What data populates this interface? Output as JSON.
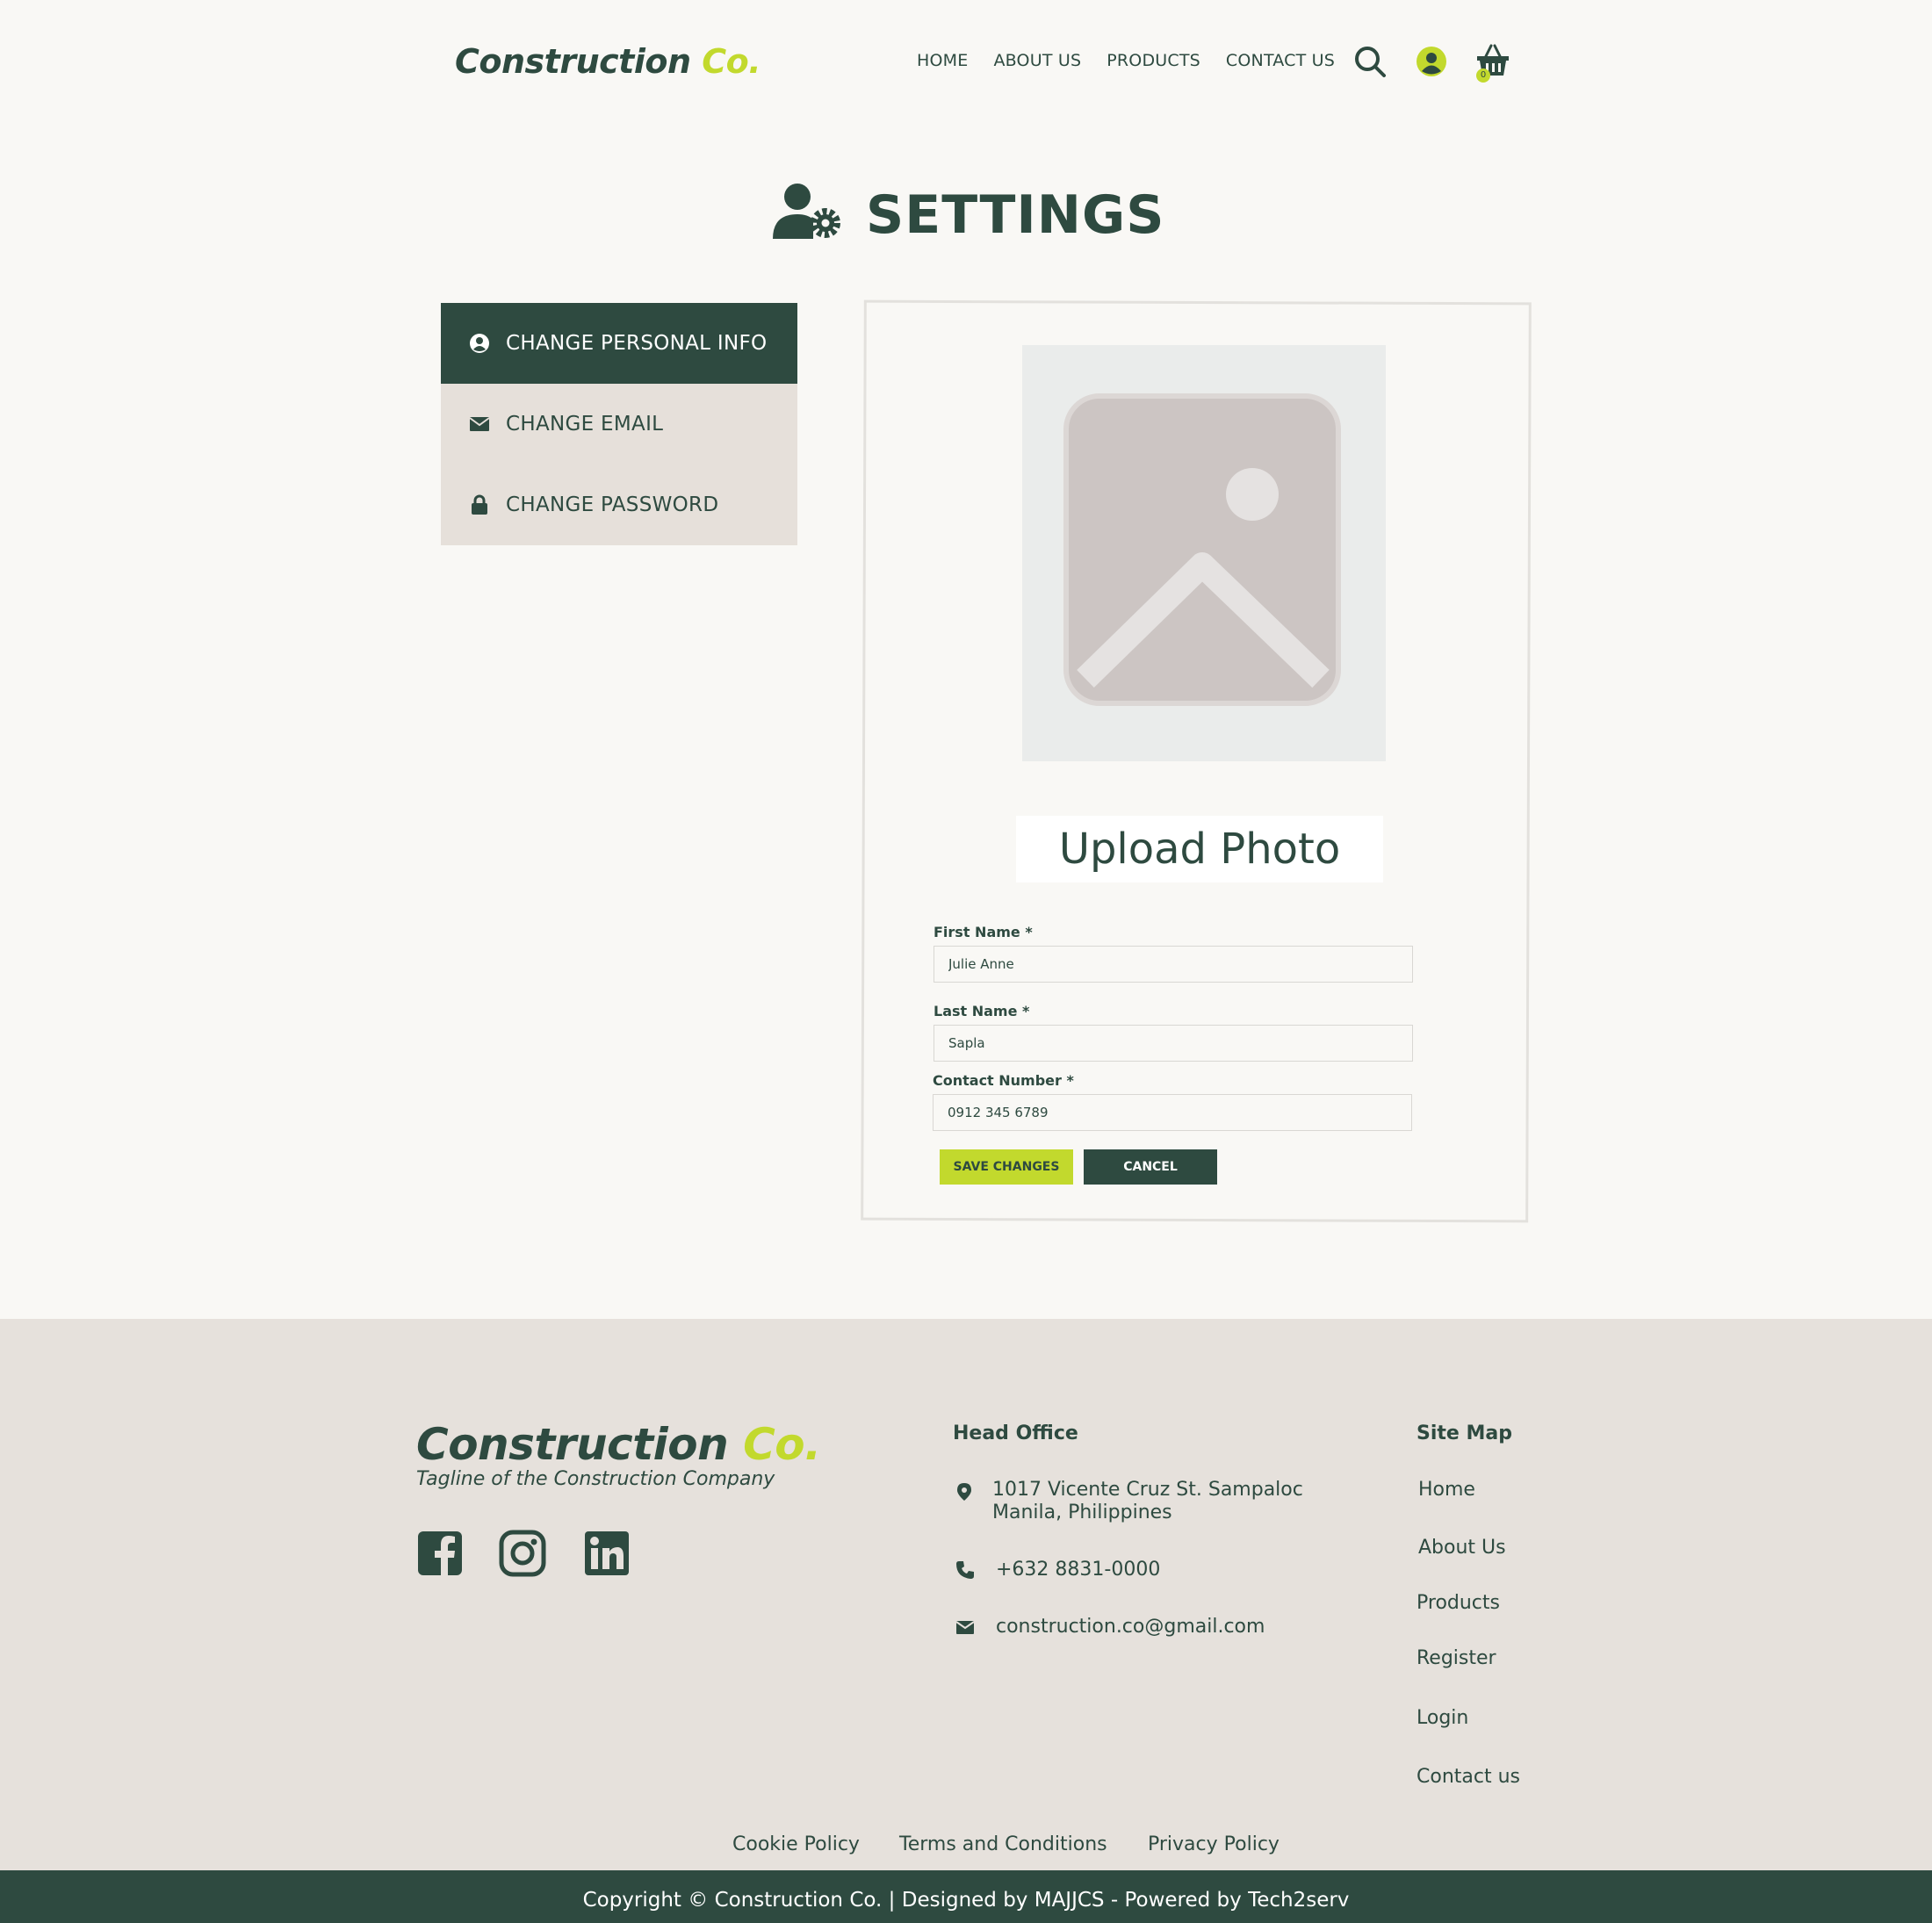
{
  "brand": {
    "name_part1": "Construction ",
    "name_part2": "Co.",
    "tagline": "Tagline of the Construction Company"
  },
  "nav": {
    "items": [
      "HOME",
      "ABOUT US",
      "PRODUCTS",
      "CONTACT US"
    ],
    "cart_count": "0"
  },
  "page": {
    "title": "SETTINGS"
  },
  "sidebar": {
    "items": [
      {
        "label": "CHANGE PERSONAL INFO",
        "icon": "user-circle-icon",
        "active": true
      },
      {
        "label": "CHANGE EMAIL",
        "icon": "envelope-icon",
        "active": false
      },
      {
        "label": "CHANGE PASSWORD",
        "icon": "lock-icon",
        "active": false
      }
    ]
  },
  "form": {
    "upload_label": "Upload Photo",
    "first_name": {
      "label": "First Name *",
      "value": "Julie Anne"
    },
    "last_name": {
      "label": "Last Name *",
      "value": "Sapla"
    },
    "contact": {
      "label": "Contact Number *",
      "value": "0912 345 6789"
    },
    "save_label": "SAVE CHANGES",
    "cancel_label": "CANCEL"
  },
  "footer": {
    "head_office": {
      "heading": "Head Office",
      "address_line1": "1017 Vicente Cruz St. Sampaloc",
      "address_line2": "Manila, Philippines",
      "phone": "+632 8831-0000",
      "email": "construction.co@gmail.com"
    },
    "site_map": {
      "heading": "Site Map",
      "links": [
        "Home",
        "About Us",
        "Products",
        "Register",
        "Login",
        "Contact us"
      ]
    },
    "legal": [
      "Cookie Policy",
      "Terms and Conditions",
      "Privacy Policy"
    ],
    "copyright": "Copyright © Construction Co.  | Designed by MAJJCS - Powered by Tech2serv"
  },
  "colors": {
    "primary": "#2e4a40",
    "accent": "#c2d92d",
    "background": "#f9f8f5",
    "footer_bg": "#e6e1dc"
  }
}
